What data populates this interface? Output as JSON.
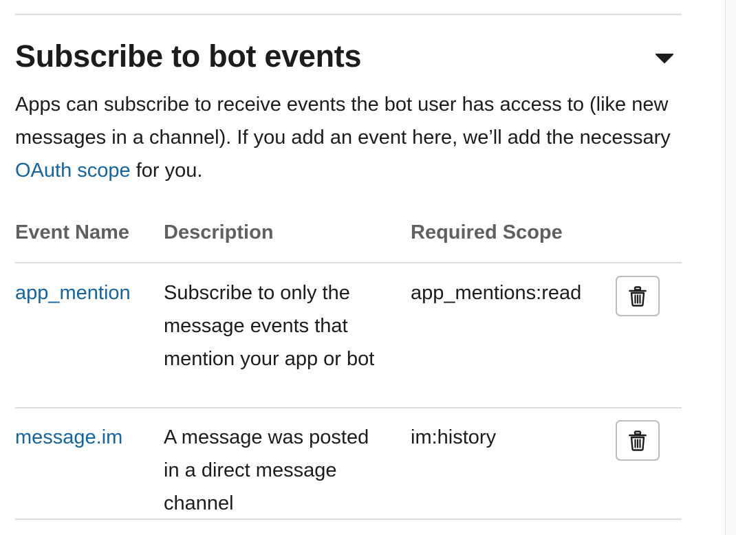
{
  "section": {
    "title": "Subscribe to bot events",
    "description_prefix": "Apps can subscribe to receive events the bot user has access to (like new messages in a channel). If you add an event here, we’ll add the necessary ",
    "description_link": "OAuth scope",
    "description_suffix": " for you."
  },
  "table": {
    "headers": {
      "event_name": "Event Name",
      "description": "Description",
      "required_scope": "Required Scope"
    },
    "rows": [
      {
        "event": "app_mention",
        "description": "Subscribe to only the message events that mention your app or bot",
        "scope": "app_mentions:read",
        "action_icon": "trash-icon"
      },
      {
        "event": "message.im",
        "description": "A message was posted in a direct message channel",
        "scope": "im:history",
        "action_icon": "trash-icon"
      }
    ]
  },
  "colors": {
    "link": "#1264a3",
    "text": "#1d1c1d",
    "header_text": "#616061",
    "divider": "#dddddd"
  }
}
